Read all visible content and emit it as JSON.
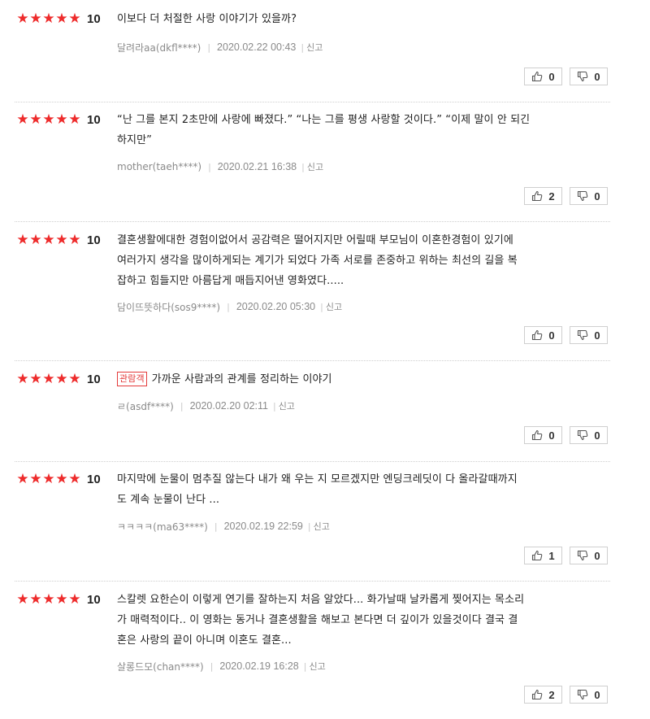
{
  "reviews": [
    {
      "score": "10",
      "badge": "",
      "lines": [
        "이보다 더 처절한 사랑 이야기가 있을까?"
      ],
      "author": "달려라aa(dkfl****)",
      "date": "2020.02.22 00:43",
      "report": "신고",
      "like": "0",
      "dislike": "0"
    },
    {
      "score": "10",
      "badge": "",
      "lines": [
        "“난 그를 본지 2초만에 사랑에 빠졌다.” “나는 그를 평생 사랑할 것이다.” “이제 말이 안 되긴",
        "하지만”"
      ],
      "author": "mother(taeh****)",
      "date": "2020.02.21 16:38",
      "report": "신고",
      "like": "2",
      "dislike": "0"
    },
    {
      "score": "10",
      "badge": "",
      "lines": [
        "결혼생활에대한 경험이없어서 공감력은 떨어지지만 어릴때 부모님이 이혼한경험이 있기에",
        "여러가지 생각을 많이하게되는 계기가 되었다 가족 서로를 존중하고 위하는 최선의 길을 복",
        "잡하고 힘들지만 아름답게 매듭지어낸 영화였다....."
      ],
      "author": "담이뜨뜻하다(sos9****)",
      "date": "2020.02.20 05:30",
      "report": "신고",
      "like": "0",
      "dislike": "0"
    },
    {
      "score": "10",
      "badge": "관람객",
      "lines": [
        "가까운 사람과의 관계를 정리하는 이야기"
      ],
      "author": "ㄹ(asdf****)",
      "date": "2020.02.20 02:11",
      "report": "신고",
      "like": "0",
      "dislike": "0"
    },
    {
      "score": "10",
      "badge": "",
      "lines": [
        "마지막에 눈물이 멈추질 않는다 내가 왜 우는 지 모르겠지만 엔딩크레딧이 다 올라갈때까지",
        "도 계속 눈물이 난다 ..."
      ],
      "author": "ㅋㅋㅋㅋ(ma63****)",
      "date": "2020.02.19 22:59",
      "report": "신고",
      "like": "1",
      "dislike": "0"
    },
    {
      "score": "10",
      "badge": "",
      "lines": [
        "스칼렛 요한슨이 이렇게 연기를 잘하는지 처음 알았다... 화가날때 날카롭게 찢어지는 목소리",
        "가 매력적이다.. 이 영화는 동거나 결혼생활을 해보고 본다면 더 깊이가 있을것이다 결국 결",
        "혼은 사랑의 끝이 아니며 이혼도 결혼..."
      ],
      "author": "살롱드모(chan****)",
      "date": "2020.02.19 16:28",
      "report": "신고",
      "like": "2",
      "dislike": "0"
    }
  ],
  "colors": {
    "star": "#ee2b2b",
    "badge": "#e43b3b",
    "meta": "#8a8a8a"
  }
}
